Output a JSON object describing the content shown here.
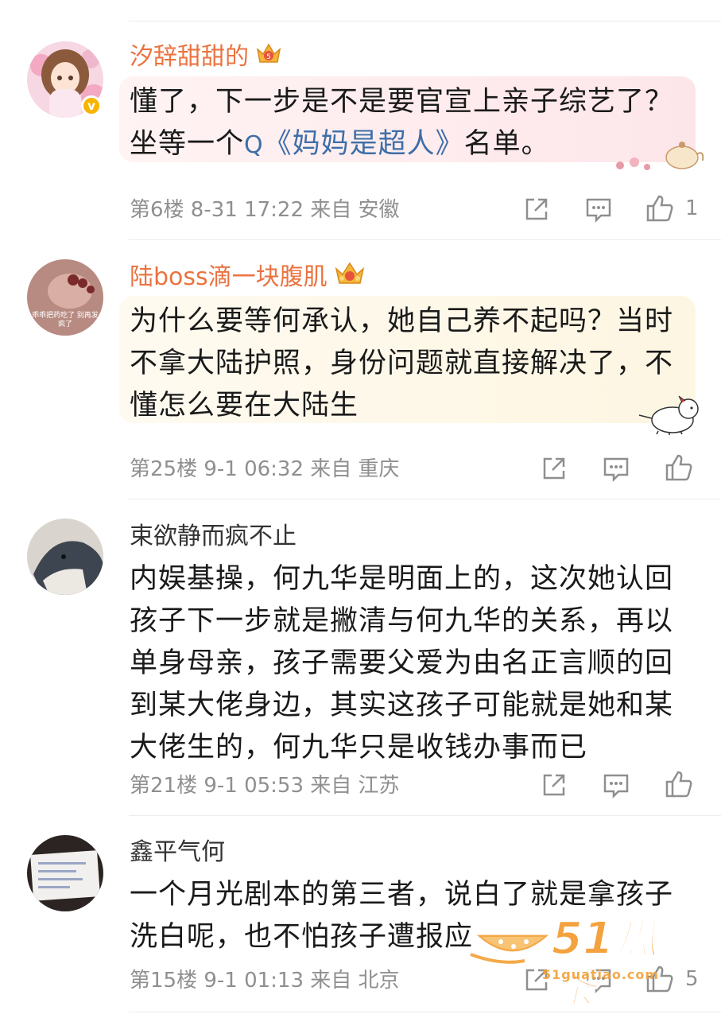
{
  "comments": [
    {
      "username": "汐辞甜甜的",
      "crown_level": "5",
      "text_before": "懂了，下一步是不是要官宣上亲子综艺了？坐等一个",
      "link_prefix": "Q",
      "link": "《妈妈是超人》",
      "text_after": "名单。",
      "meta": "第6楼  8-31 17:22  来自 安徽",
      "like_count": "1",
      "verified": true,
      "bubble_color": "#fdeeee"
    },
    {
      "username": "陆boss滴一块腹肌",
      "crown_level": "",
      "text": "为什么要等何承认，她自己养不起吗？当时不拿大陆护照，身份问题就直接解决了，不懂怎么要在大陆生",
      "avatar_caption": "乖乖把药吃了 别再发疯了",
      "meta": "第25楼  9-1 06:32  来自 重庆",
      "like_count": "",
      "bubble_color": "#fdf8e9"
    },
    {
      "username": "束欲静而疯不止",
      "text": "内娱基操，何九华是明面上的，这次她认回孩子下一步就是撇清与何九华的关系，再以单身母亲，孩子需要父爱为由名正言顺的回到某大佬身边，其实这孩子可能就是她和某大佬生的，何九华只是收钱办事而已",
      "meta": "第21楼  9-1 05:53  来自 江苏",
      "like_count": ""
    },
    {
      "username": "鑫平气何",
      "text": "一个月光剧本的第三者，说白了就是拿孩子洗白呢，也不怕孩子遭报应",
      "meta": "第15楼  9-1 01:13  来自 北京",
      "like_count": "5"
    }
  ],
  "watermark": {
    "brand": "51瓜条",
    "domain": "51guatiao.com"
  },
  "icons": {
    "share": "share-icon",
    "comment": "comment-icon",
    "like": "thumbs-up-icon",
    "crown": "crown-badge-icon",
    "verified": "verified-badge-icon"
  },
  "colors": {
    "vip_name": "#eb7340",
    "link": "#3e6ea8",
    "meta": "#8f8f8f"
  }
}
